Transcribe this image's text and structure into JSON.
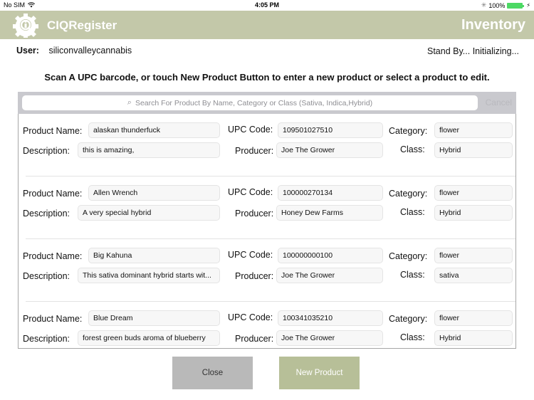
{
  "status_bar": {
    "carrier": "No SIM",
    "time": "4:05 PM",
    "battery": "100%"
  },
  "header": {
    "app_title": "CIQRegister",
    "page_title": "Inventory",
    "brand_color": "#c3c8a9"
  },
  "user": {
    "label": "User:",
    "name": "siliconvalleycannabis"
  },
  "status_text": "Stand By... Initializing...",
  "instruction": "Scan A UPC barcode, or touch New Product Button to enter a new product or select a product to edit.",
  "search": {
    "placeholder": "Search For Product By Name, Category or Class (Sativa, Indica,Hybrid)",
    "cancel_label": "Cancel"
  },
  "labels": {
    "product_name": "Product Name:",
    "description": "Description:",
    "upc_code": "UPC Code:",
    "producer": "Producer:",
    "category": "Category:",
    "class": "Class:"
  },
  "products": [
    {
      "name": "alaskan thunderfuck",
      "description": "this is amazing,",
      "upc": "109501027510",
      "producer": "Joe The Grower",
      "category": "flower",
      "class": "Hybrid"
    },
    {
      "name": "Allen Wrench",
      "description": "A very special hybrid",
      "upc": "100000270134",
      "producer": "Honey Dew Farms",
      "category": "flower",
      "class": "Hybrid"
    },
    {
      "name": "Big Kahuna",
      "description": "This sativa dominant hybrid starts wit...",
      "upc": "100000000100",
      "producer": "Joe The Grower",
      "category": "flower",
      "class": "sativa"
    },
    {
      "name": "Blue Dream",
      "description": "forest green buds  aroma of blueberry",
      "upc": "100341035210",
      "producer": "Joe The Grower",
      "category": "flower",
      "class": "Hybrid"
    }
  ],
  "buttons": {
    "close": "Close",
    "new_product": "New Product"
  }
}
